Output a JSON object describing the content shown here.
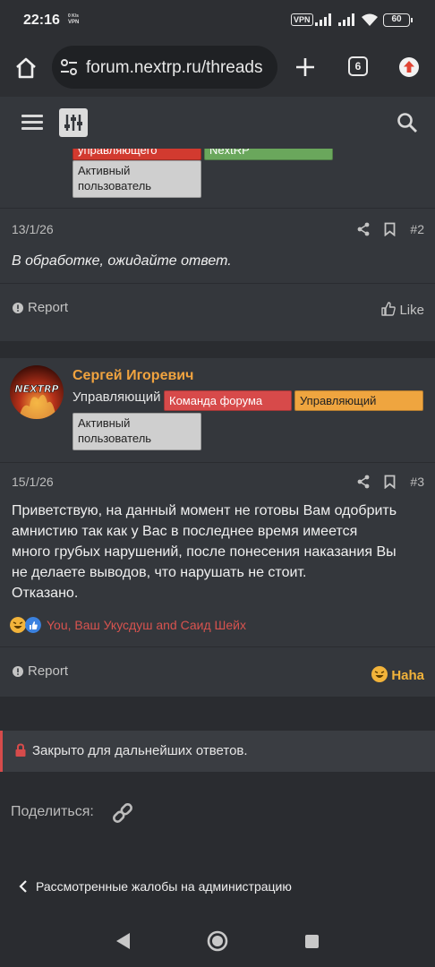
{
  "status_bar": {
    "time": "22:16",
    "speed_line1": "0 K/s",
    "speed_line2": "VPN",
    "vpn_label": "VPN",
    "battery": "60"
  },
  "browser": {
    "url": "forum.nextrp.ru/threads",
    "tab_count": "6"
  },
  "post_top": {
    "badges": [
      "управляющего",
      "NextRP",
      "Активный пользователь"
    ],
    "date": "13/1/26",
    "number": "#2",
    "message": "В обработке, ожидайте ответ.",
    "report_label": "Report",
    "like_label": "Like"
  },
  "post_main": {
    "username": "Сергей Игоревич",
    "user_title": "Управляющий",
    "avatar_text": "NEXTRP",
    "badges": [
      "Команда форума",
      "Управляющий",
      "Активный пользователь"
    ],
    "date": "15/1/26",
    "number": "#3",
    "message_lines": [
      "Приветствую, на данный момент не готовы Вам одобрить",
      "амнистию так как у Вас в последнее время имеется",
      "много грубых нарушений, после понесения наказания Вы",
      "не делаете выводов, что нарушать не стоит.",
      "Отказано."
    ],
    "reactions_text": "You, Ваш Укусдуш and Саид Шейх",
    "report_label": "Report",
    "reaction_label": "Haha"
  },
  "thread_closed": "Закрыто для дальнейших ответов.",
  "share_label": "Поделиться:",
  "breadcrumb": "Рассмотренные жалобы на администрацию",
  "colors": {
    "username": "#f0a33f",
    "badge_red": "#d23a2f",
    "badge_green": "#6aa75c",
    "badge_orange": "#efa53f",
    "reactions": "#d8534f",
    "haha": "#f2b33a"
  },
  "icons": [
    "home-icon",
    "tune-icon",
    "plus-icon",
    "tab-switcher-icon",
    "update-icon",
    "menu-icon",
    "filter-icon",
    "search-icon",
    "share-icon",
    "bookmark-icon",
    "report-icon",
    "like-icon",
    "haha-icon",
    "lock-icon",
    "link-icon",
    "chevron-left-icon",
    "back-icon",
    "home-circle-icon",
    "recents-icon"
  ]
}
